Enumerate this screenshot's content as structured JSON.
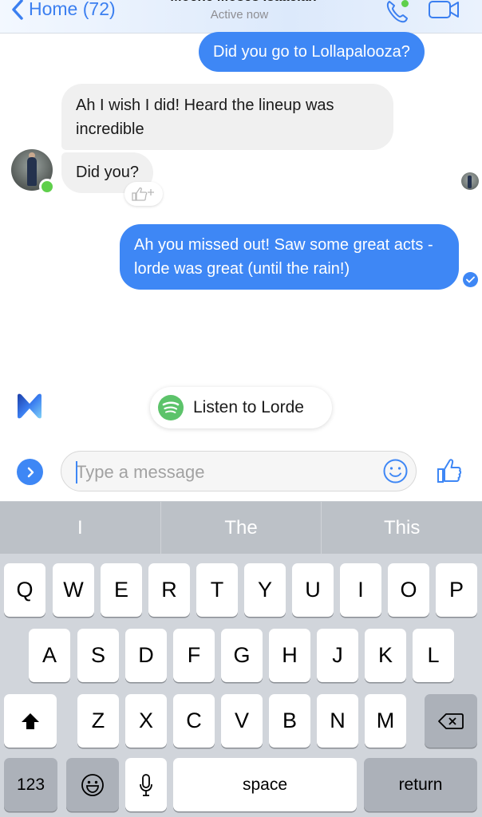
{
  "header": {
    "back_label": "Home (72)",
    "contact_name": "Moche Moses Isaacian",
    "status": "Active now",
    "call_icon": "phone-icon",
    "video_icon": "video-camera-icon"
  },
  "messages": [
    {
      "direction": "outgoing",
      "text": "Did you go to Lollapalooza?"
    },
    {
      "direction": "incoming",
      "text": "Ah I wish I did! Heard the lineup was incredible"
    },
    {
      "direction": "incoming",
      "text": "Did you?"
    },
    {
      "direction": "outgoing",
      "text": "Ah you missed out! Saw some great acts - lorde was great (until the rain!)"
    }
  ],
  "suggestion": {
    "label": "Listen to Lorde",
    "icon": "spotify-icon"
  },
  "composer": {
    "placeholder": "Type a message",
    "value": ""
  },
  "keyboard": {
    "predictions": [
      "I",
      "The",
      "This"
    ],
    "row1": [
      "Q",
      "W",
      "E",
      "R",
      "T",
      "Y",
      "U",
      "I",
      "O",
      "P"
    ],
    "row2": [
      "A",
      "S",
      "D",
      "F",
      "G",
      "H",
      "J",
      "K",
      "L"
    ],
    "row3": [
      "Z",
      "X",
      "C",
      "V",
      "B",
      "N",
      "M"
    ],
    "numbers_label": "123",
    "space_label": "space",
    "return_label": "return"
  },
  "colors": {
    "accent": "#3e87f5",
    "online": "#5fcf4b",
    "spotify": "#5cc36a",
    "incoming_bubble": "#f0f0f0"
  }
}
